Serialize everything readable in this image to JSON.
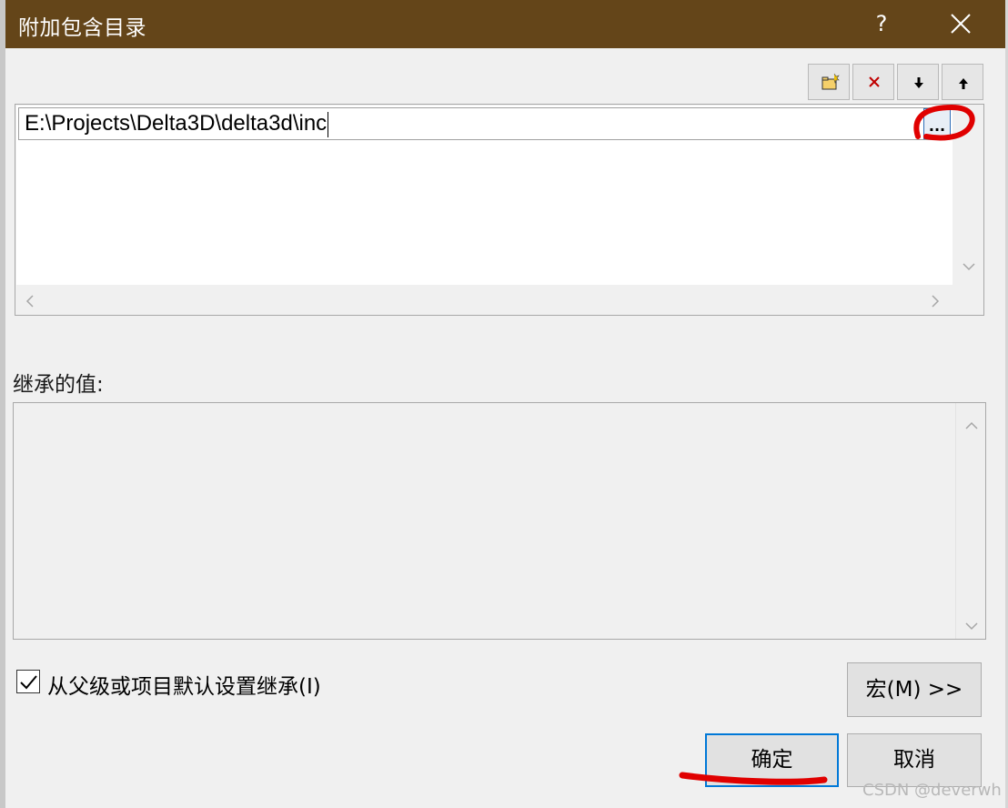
{
  "window": {
    "title": "附加包含目录",
    "help_label": "?",
    "close_icon": "close-icon"
  },
  "toolbar": {
    "buttons": [
      {
        "name": "new-line-button",
        "icon": "new-folder-icon"
      },
      {
        "name": "delete-button",
        "icon": "delete-x-icon"
      },
      {
        "name": "move-down-button",
        "icon": "arrow-down-icon"
      },
      {
        "name": "move-up-button",
        "icon": "arrow-up-icon"
      }
    ]
  },
  "directory_list": {
    "items": [
      {
        "value": "E:\\Projects\\Delta3D\\delta3d\\inc"
      }
    ],
    "browse_label": "..."
  },
  "inherited": {
    "label": "继承的值:",
    "items": []
  },
  "inherit_checkbox": {
    "label": "从父级或项目默认设置继承(I)",
    "checked": true
  },
  "buttons": {
    "macro": "宏(M) >>",
    "ok": "确定",
    "cancel": "取消"
  },
  "watermark": "CSDN @deverwh",
  "colors": {
    "titlebar": "#644519",
    "annotation": "#e00000",
    "focus": "#0078d7"
  }
}
